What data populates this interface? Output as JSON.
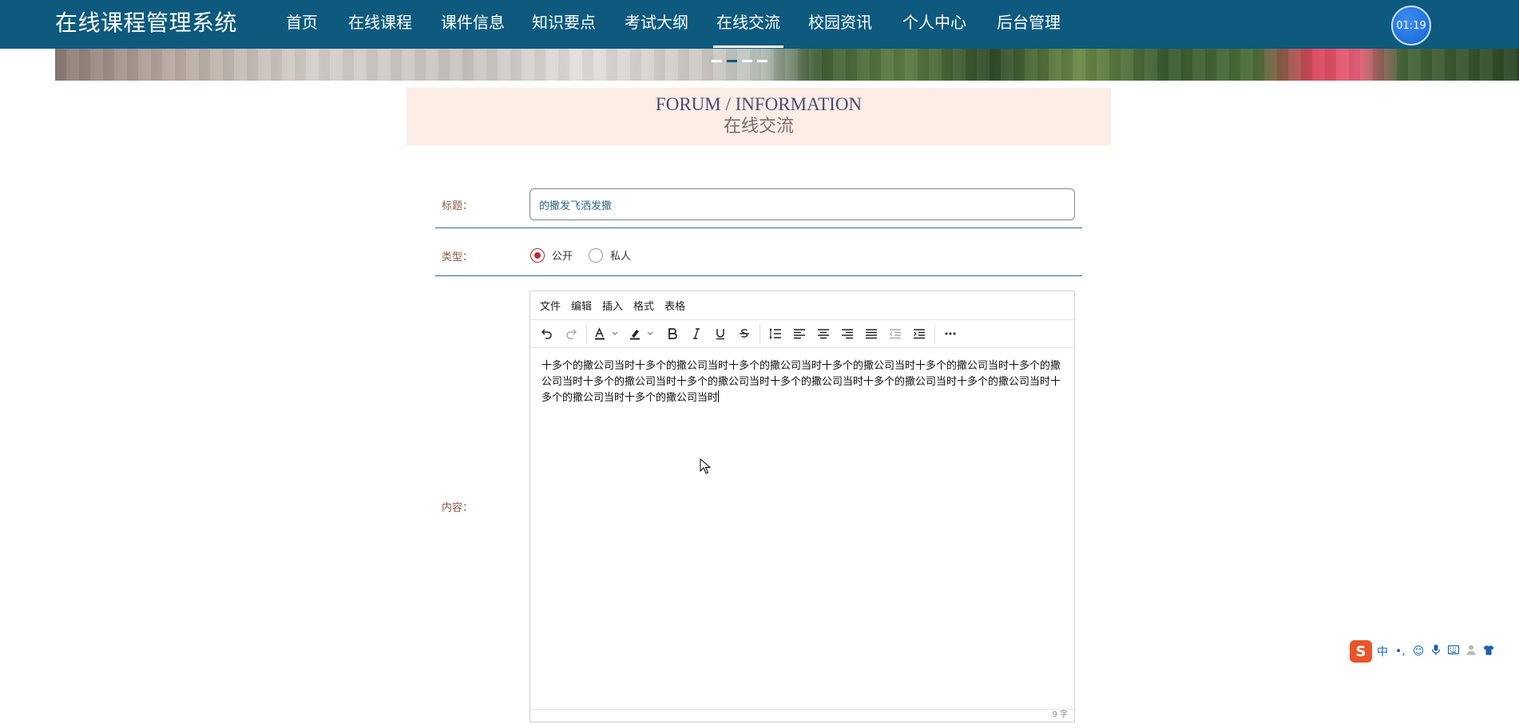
{
  "brand": "在线课程管理系统",
  "nav": [
    {
      "label": "首页"
    },
    {
      "label": "在线课程"
    },
    {
      "label": "课件信息"
    },
    {
      "label": "知识要点"
    },
    {
      "label": "考试大纲"
    },
    {
      "label": "在线交流",
      "active": true
    },
    {
      "label": "校园资讯"
    },
    {
      "label": "个人中心"
    },
    {
      "label": "后台管理"
    }
  ],
  "timer": "01:19",
  "section": {
    "title_en": "FORUM / INFORMATION",
    "title_cn": "在线交流"
  },
  "form": {
    "title_label": "标题：",
    "title_value": "的撒发飞洒发撒",
    "type_label": "类型：",
    "type_options": [
      "公开",
      "私人"
    ],
    "type_selected": "公开",
    "content_label": "内容："
  },
  "editor": {
    "menu": [
      "文件",
      "编辑",
      "插入",
      "格式",
      "表格"
    ],
    "toolbar_icons": [
      "undo-icon",
      "redo-icon",
      "text-color-icon",
      "highlight-icon",
      "bold-icon",
      "italic-icon",
      "underline-icon",
      "strikethrough-icon",
      "line-height-icon",
      "align-left-icon",
      "align-center-icon",
      "align-right-icon",
      "align-justify-icon",
      "outdent-icon",
      "indent-icon",
      "more-icon"
    ],
    "content": "十多个的撒公司当时十多个的撒公司当时十多个的撒公司当时十多个的撒公司当时十多个的撒公司当时十多个的撒公司当时十多个的撒公司当时十多个的撒公司当时十多个的撒公司当时十多个的撒公司当时十多个的撒公司当时十多个的撒公司当时十多个的撒公司当时",
    "word_count": "9 字"
  },
  "ime": {
    "logo": "S",
    "mode": "中",
    "punct": "•,",
    "icons": [
      "emoji-icon",
      "mic-icon",
      "keyboard-icon",
      "user-icon",
      "skin-icon"
    ]
  },
  "colors": {
    "nav_bg": "#0d5a7e",
    "section_bg": "#fbece6",
    "radio_accent": "#c0282d",
    "label_color": "#8a5a44"
  }
}
